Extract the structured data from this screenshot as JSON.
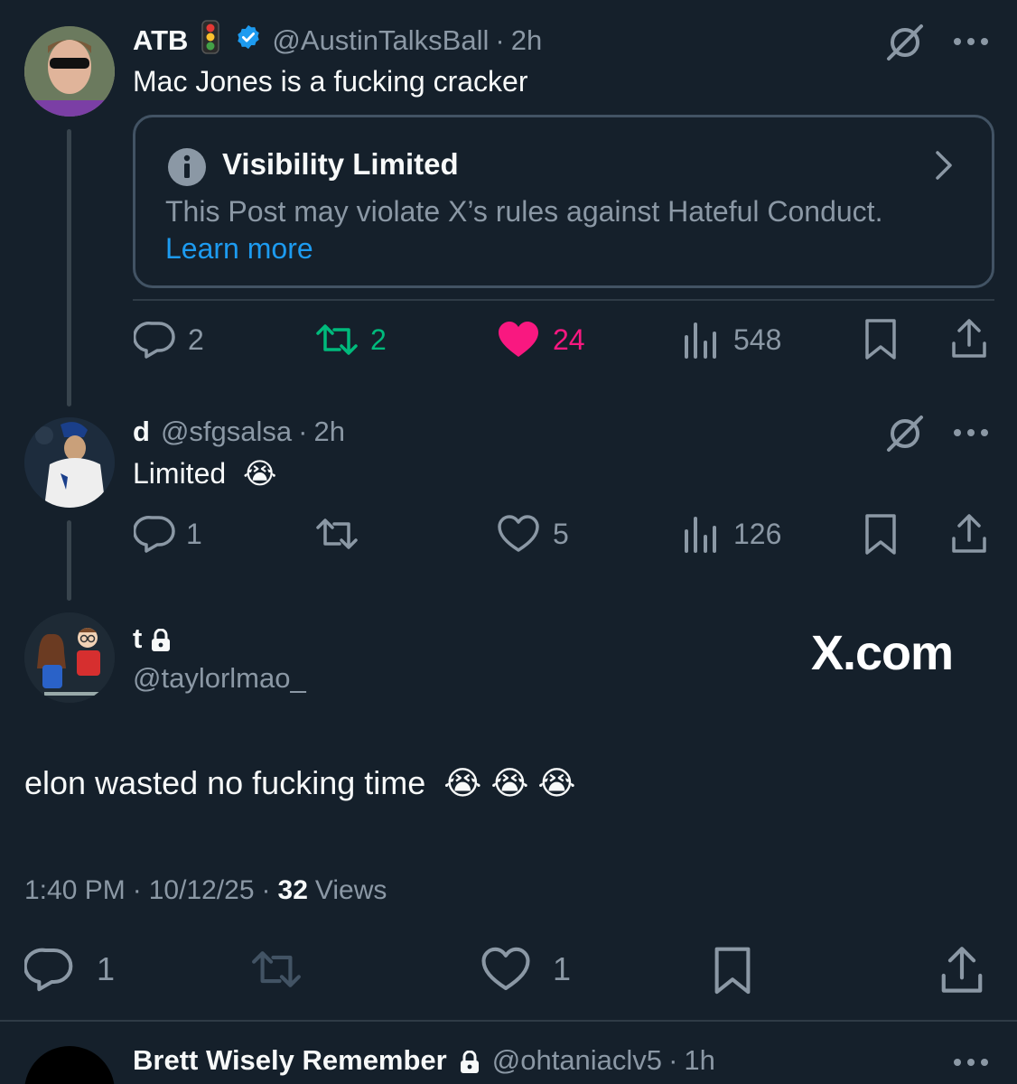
{
  "post1": {
    "name": "ATB",
    "handle": "@AustinTalksBall",
    "time": "2h",
    "text": "Mac Jones is a fucking cracker",
    "notice": {
      "title": "Visibility Limited",
      "text": "This Post may violate X’s rules against Hateful Conduct.",
      "link": "Learn more"
    },
    "replies": "2",
    "reposts": "2",
    "likes": "24",
    "views": "548"
  },
  "post2": {
    "name": "d",
    "handle": "@sfgsalsa",
    "time": "2h",
    "text": "Limited",
    "emoji": "😭",
    "replies": "1",
    "likes": "5",
    "views": "126"
  },
  "main_post": {
    "name": "t",
    "handle": "@taylorlmao_",
    "text": "elon wasted no fucking time",
    "emojis": "😭 😭 😭",
    "time": "1:40 PM",
    "date": "10/12/25",
    "views_count": "32",
    "views_label": "Views",
    "replies": "1",
    "likes": "1",
    "watermark": "X.com"
  },
  "post4": {
    "name": "Brett Wisely Remember",
    "handle": "@ohtaniaclv5",
    "time": "1h"
  },
  "separator": "·",
  "colors": {
    "background": "#15202b",
    "muted": "#8b98a5",
    "link": "#1d9bf0",
    "repost_active": "#00ba7c",
    "like_active": "#f91880",
    "verified": "#1d9bf0"
  }
}
